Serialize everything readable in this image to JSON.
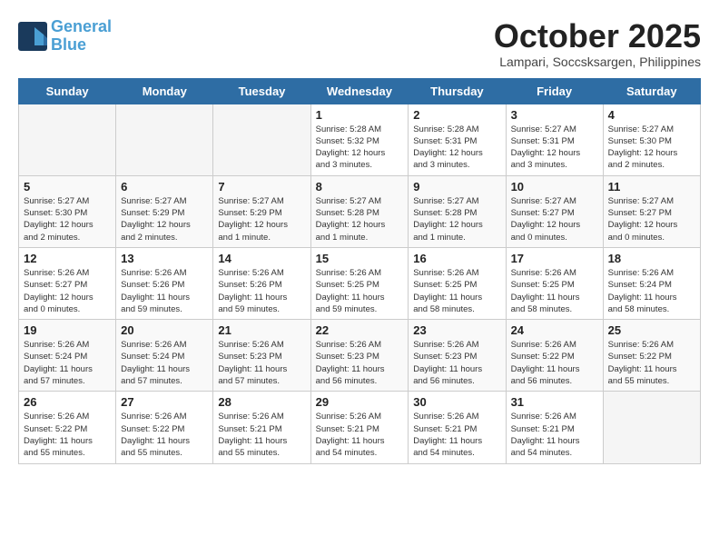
{
  "logo": {
    "line1": "General",
    "line2": "Blue"
  },
  "title": "October 2025",
  "subtitle": "Lampari, Soccsksargen, Philippines",
  "weekdays": [
    "Sunday",
    "Monday",
    "Tuesday",
    "Wednesday",
    "Thursday",
    "Friday",
    "Saturday"
  ],
  "weeks": [
    [
      {
        "day": "",
        "info": ""
      },
      {
        "day": "",
        "info": ""
      },
      {
        "day": "",
        "info": ""
      },
      {
        "day": "1",
        "info": "Sunrise: 5:28 AM\nSunset: 5:32 PM\nDaylight: 12 hours\nand 3 minutes."
      },
      {
        "day": "2",
        "info": "Sunrise: 5:28 AM\nSunset: 5:31 PM\nDaylight: 12 hours\nand 3 minutes."
      },
      {
        "day": "3",
        "info": "Sunrise: 5:27 AM\nSunset: 5:31 PM\nDaylight: 12 hours\nand 3 minutes."
      },
      {
        "day": "4",
        "info": "Sunrise: 5:27 AM\nSunset: 5:30 PM\nDaylight: 12 hours\nand 2 minutes."
      }
    ],
    [
      {
        "day": "5",
        "info": "Sunrise: 5:27 AM\nSunset: 5:30 PM\nDaylight: 12 hours\nand 2 minutes."
      },
      {
        "day": "6",
        "info": "Sunrise: 5:27 AM\nSunset: 5:29 PM\nDaylight: 12 hours\nand 2 minutes."
      },
      {
        "day": "7",
        "info": "Sunrise: 5:27 AM\nSunset: 5:29 PM\nDaylight: 12 hours\nand 1 minute."
      },
      {
        "day": "8",
        "info": "Sunrise: 5:27 AM\nSunset: 5:28 PM\nDaylight: 12 hours\nand 1 minute."
      },
      {
        "day": "9",
        "info": "Sunrise: 5:27 AM\nSunset: 5:28 PM\nDaylight: 12 hours\nand 1 minute."
      },
      {
        "day": "10",
        "info": "Sunrise: 5:27 AM\nSunset: 5:27 PM\nDaylight: 12 hours\nand 0 minutes."
      },
      {
        "day": "11",
        "info": "Sunrise: 5:27 AM\nSunset: 5:27 PM\nDaylight: 12 hours\nand 0 minutes."
      }
    ],
    [
      {
        "day": "12",
        "info": "Sunrise: 5:26 AM\nSunset: 5:27 PM\nDaylight: 12 hours\nand 0 minutes."
      },
      {
        "day": "13",
        "info": "Sunrise: 5:26 AM\nSunset: 5:26 PM\nDaylight: 11 hours\nand 59 minutes."
      },
      {
        "day": "14",
        "info": "Sunrise: 5:26 AM\nSunset: 5:26 PM\nDaylight: 11 hours\nand 59 minutes."
      },
      {
        "day": "15",
        "info": "Sunrise: 5:26 AM\nSunset: 5:25 PM\nDaylight: 11 hours\nand 59 minutes."
      },
      {
        "day": "16",
        "info": "Sunrise: 5:26 AM\nSunset: 5:25 PM\nDaylight: 11 hours\nand 58 minutes."
      },
      {
        "day": "17",
        "info": "Sunrise: 5:26 AM\nSunset: 5:25 PM\nDaylight: 11 hours\nand 58 minutes."
      },
      {
        "day": "18",
        "info": "Sunrise: 5:26 AM\nSunset: 5:24 PM\nDaylight: 11 hours\nand 58 minutes."
      }
    ],
    [
      {
        "day": "19",
        "info": "Sunrise: 5:26 AM\nSunset: 5:24 PM\nDaylight: 11 hours\nand 57 minutes."
      },
      {
        "day": "20",
        "info": "Sunrise: 5:26 AM\nSunset: 5:24 PM\nDaylight: 11 hours\nand 57 minutes."
      },
      {
        "day": "21",
        "info": "Sunrise: 5:26 AM\nSunset: 5:23 PM\nDaylight: 11 hours\nand 57 minutes."
      },
      {
        "day": "22",
        "info": "Sunrise: 5:26 AM\nSunset: 5:23 PM\nDaylight: 11 hours\nand 56 minutes."
      },
      {
        "day": "23",
        "info": "Sunrise: 5:26 AM\nSunset: 5:23 PM\nDaylight: 11 hours\nand 56 minutes."
      },
      {
        "day": "24",
        "info": "Sunrise: 5:26 AM\nSunset: 5:22 PM\nDaylight: 11 hours\nand 56 minutes."
      },
      {
        "day": "25",
        "info": "Sunrise: 5:26 AM\nSunset: 5:22 PM\nDaylight: 11 hours\nand 55 minutes."
      }
    ],
    [
      {
        "day": "26",
        "info": "Sunrise: 5:26 AM\nSunset: 5:22 PM\nDaylight: 11 hours\nand 55 minutes."
      },
      {
        "day": "27",
        "info": "Sunrise: 5:26 AM\nSunset: 5:22 PM\nDaylight: 11 hours\nand 55 minutes."
      },
      {
        "day": "28",
        "info": "Sunrise: 5:26 AM\nSunset: 5:21 PM\nDaylight: 11 hours\nand 55 minutes."
      },
      {
        "day": "29",
        "info": "Sunrise: 5:26 AM\nSunset: 5:21 PM\nDaylight: 11 hours\nand 54 minutes."
      },
      {
        "day": "30",
        "info": "Sunrise: 5:26 AM\nSunset: 5:21 PM\nDaylight: 11 hours\nand 54 minutes."
      },
      {
        "day": "31",
        "info": "Sunrise: 5:26 AM\nSunset: 5:21 PM\nDaylight: 11 hours\nand 54 minutes."
      },
      {
        "day": "",
        "info": ""
      }
    ]
  ]
}
